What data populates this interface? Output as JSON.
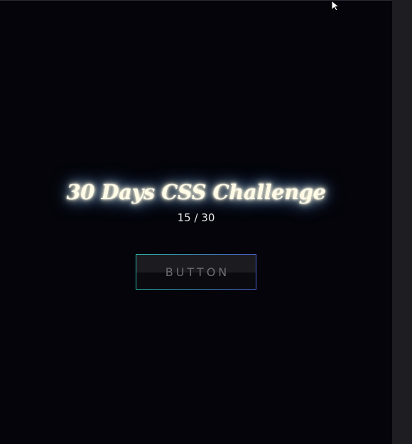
{
  "hero": {
    "title": "30 Days CSS Challenge",
    "progress_label": "15 / 30"
  },
  "demo": {
    "button_label": "BUTTON"
  },
  "colors": {
    "background": "#04040a",
    "title_glow": "#6aa8ff",
    "button_border_start": "#2bb3a8",
    "button_border_end": "#4b5fc9"
  },
  "icons": {
    "cursor": "mouse-pointer-icon"
  }
}
